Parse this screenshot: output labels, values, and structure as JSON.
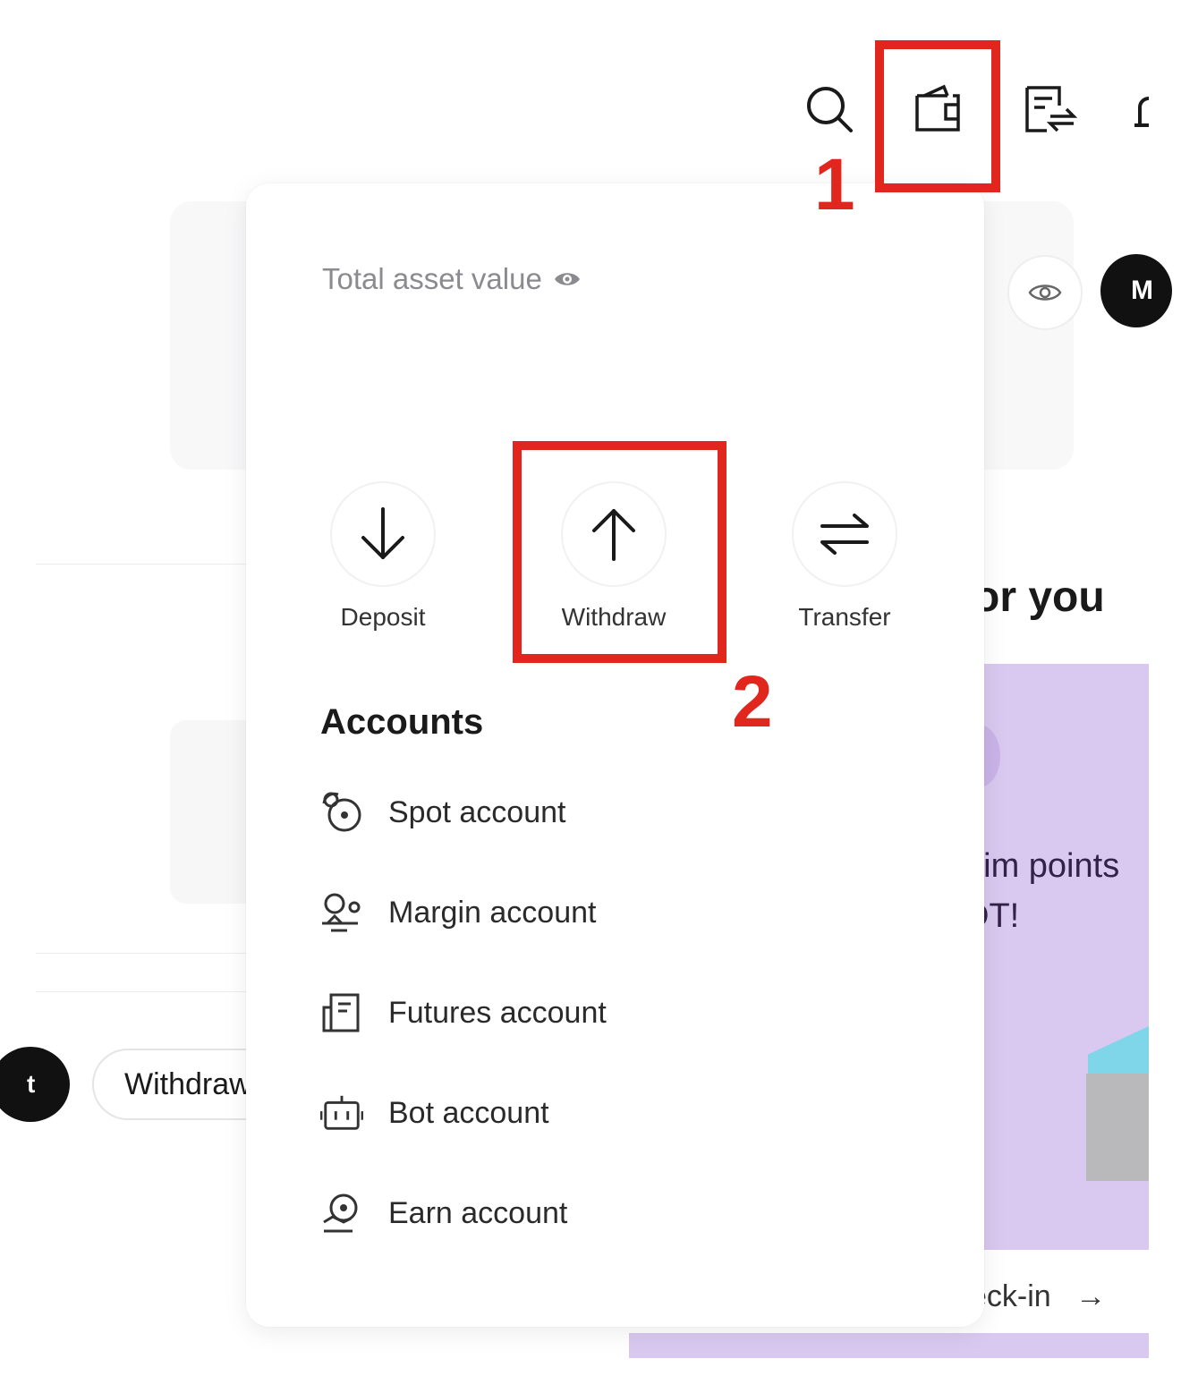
{
  "header": {
    "icons": [
      "search-icon",
      "wallet-icon",
      "orders-icon",
      "bell-icon"
    ]
  },
  "background": {
    "for_you_text": "or you",
    "promo_text_line1": "aim points",
    "promo_text_line2": "DT!",
    "checkin_text": "eck-in",
    "left_avatar_letter": "t",
    "right_avatar_letter": "M",
    "withdraw_button_label": "Withdraw"
  },
  "wallet_popup": {
    "total_asset_label": "Total asset value",
    "actions": [
      {
        "label": "Deposit",
        "icon": "arrow-down-icon"
      },
      {
        "label": "Withdraw",
        "icon": "arrow-up-icon"
      },
      {
        "label": "Transfer",
        "icon": "transfer-icon"
      }
    ],
    "accounts_title": "Accounts",
    "accounts": [
      {
        "label": "Spot account",
        "icon": "spot-icon"
      },
      {
        "label": "Margin account",
        "icon": "margin-icon"
      },
      {
        "label": "Futures account",
        "icon": "futures-icon"
      },
      {
        "label": "Bot account",
        "icon": "bot-icon"
      },
      {
        "label": "Earn account",
        "icon": "earn-icon"
      }
    ]
  },
  "annotations": {
    "step1": "1",
    "step2": "2",
    "color": "#e0261d"
  }
}
